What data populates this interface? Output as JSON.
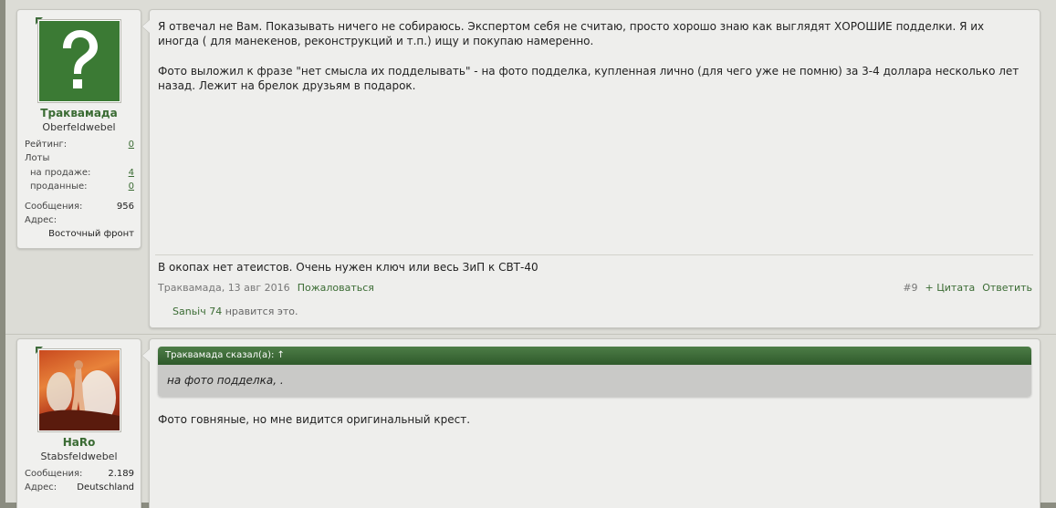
{
  "post1": {
    "username": "Траквамада",
    "usertitle": "Oberfeldwebel",
    "stats": {
      "rating_label": "Рейтинг:",
      "rating_value": "0",
      "lots_label": "Лоты",
      "for_sale_label": "на продаже:",
      "for_sale_value": "4",
      "sold_label": "проданные:",
      "sold_value": "0",
      "messages_label": "Сообщения:",
      "messages_value": "956",
      "address_label": "Адрес:",
      "address_value": "Восточный фронт"
    },
    "paragraph1": "Я отвечал не Вам. Показывать ничего не собираюсь. Экспертом себя не считаю, просто хорошо знаю как выглядят ХОРОШИЕ подделки. Я их иногда ( для манекенов, реконструкций и т.п.) ищу и покупаю намеренно.",
    "paragraph2": "Фото выложил к фразе \"нет смысла их подделывать\" - на фото подделка, купленная лично (для чего уже не помню) за 3-4 доллара несколько лет назад. Лежит на брелок друзьям в подарок.",
    "signature": "В окопах нет атеистов. Очень нужен ключ или весь ЗиП к СВТ-40",
    "meta_author_date": "Траквамада, 13 авг 2016",
    "report_label": "Пожаловаться",
    "post_number": "#9",
    "quote_label": "+ Цитата",
    "reply_label": "Ответить",
    "liker": "Sanьіч 74",
    "likes_suffix": " нравится это."
  },
  "post2": {
    "username": "HaRo",
    "usertitle": "Stabsfeldwebel",
    "stats": {
      "messages_label": "Сообщения:",
      "messages_value": "2.189",
      "address_label": "Адрес:",
      "address_value": "Deutschland"
    },
    "quote_header": "Траквамада сказал(а): ↑",
    "quote_text": "на фото подделка, .",
    "message": "Фото говняные, но мне видится оригинальный крест."
  }
}
